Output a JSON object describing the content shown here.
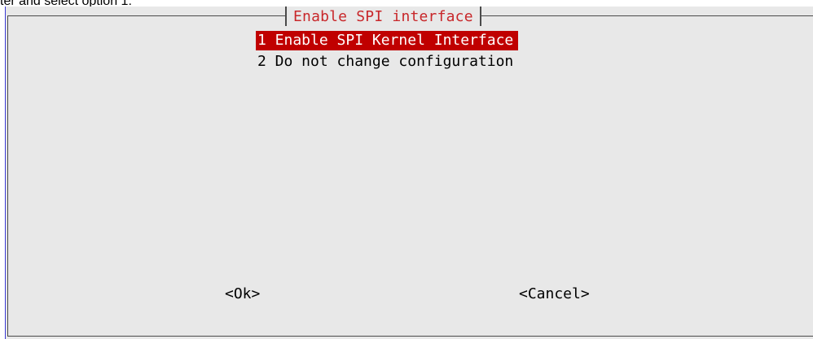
{
  "caption": "ter and select option 1:",
  "dialog": {
    "title": "Enable SPI interface",
    "options": [
      {
        "label": "1 Enable SPI Kernel Interface",
        "selected": true
      },
      {
        "label": "2 Do not change configuration",
        "selected": false
      }
    ],
    "ok_label": "<Ok>",
    "cancel_label": "<Cancel>"
  },
  "colors": {
    "background": "#e8e8e8",
    "title_text": "#c8272a",
    "selection": "#c00000",
    "frame": "#4a4a4a"
  }
}
